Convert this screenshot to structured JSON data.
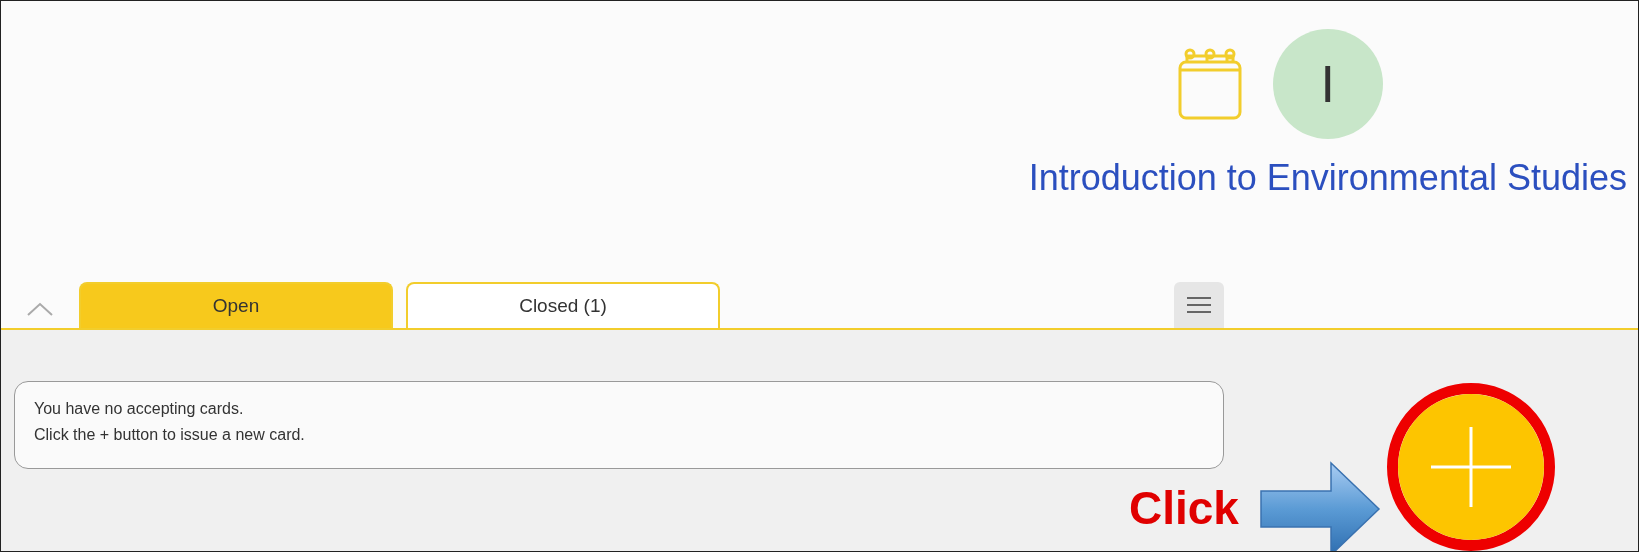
{
  "header": {
    "avatar_letter": "I",
    "title": "Introduction to Environmental Studies"
  },
  "tabs": [
    {
      "label": "Open",
      "selected": true
    },
    {
      "label": "Closed (1)",
      "selected": false
    }
  ],
  "message": [
    "You have no accepting cards.",
    "Click the + button to issue a new card."
  ],
  "annotation": {
    "label": "Click",
    "highlighted": true
  }
}
